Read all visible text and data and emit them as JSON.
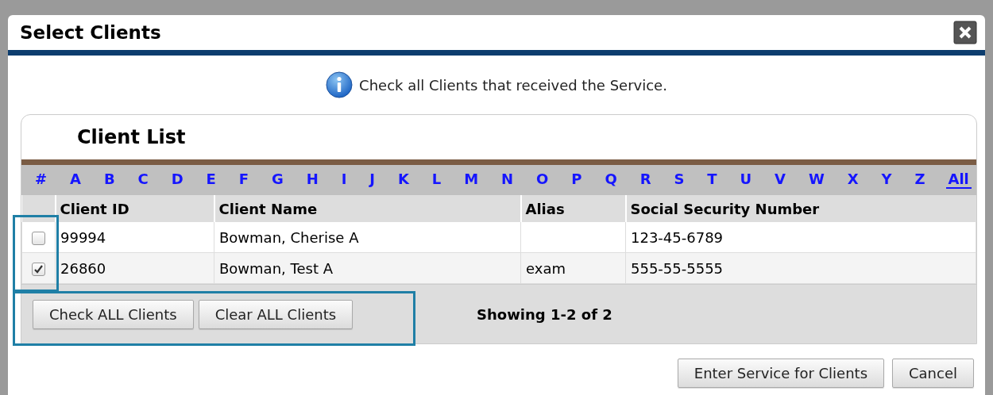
{
  "dialog": {
    "title": "Select Clients"
  },
  "info_message": "Check all Clients that received the Service.",
  "client_list": {
    "title": "Client List",
    "letters": [
      {
        "label": "#",
        "selected": false
      },
      {
        "label": "A",
        "selected": false
      },
      {
        "label": "B",
        "selected": false
      },
      {
        "label": "C",
        "selected": false
      },
      {
        "label": "D",
        "selected": false
      },
      {
        "label": "E",
        "selected": false
      },
      {
        "label": "F",
        "selected": false
      },
      {
        "label": "G",
        "selected": false
      },
      {
        "label": "H",
        "selected": false
      },
      {
        "label": "I",
        "selected": false
      },
      {
        "label": "J",
        "selected": false
      },
      {
        "label": "K",
        "selected": false
      },
      {
        "label": "L",
        "selected": false
      },
      {
        "label": "M",
        "selected": false
      },
      {
        "label": "N",
        "selected": false
      },
      {
        "label": "O",
        "selected": false
      },
      {
        "label": "P",
        "selected": false
      },
      {
        "label": "Q",
        "selected": false
      },
      {
        "label": "R",
        "selected": false
      },
      {
        "label": "S",
        "selected": false
      },
      {
        "label": "T",
        "selected": false
      },
      {
        "label": "U",
        "selected": false
      },
      {
        "label": "V",
        "selected": false
      },
      {
        "label": "W",
        "selected": false
      },
      {
        "label": "X",
        "selected": false
      },
      {
        "label": "Y",
        "selected": false
      },
      {
        "label": "Z",
        "selected": false
      },
      {
        "label": "All",
        "selected": true
      }
    ],
    "columns": [
      "Client ID",
      "Client Name",
      "Alias",
      "Social Security Number"
    ],
    "rows": [
      {
        "checked": false,
        "client_id": "99994",
        "client_name": "Bowman, Cherise A",
        "ssn": "123-45-6789"
      },
      {
        "checked": true,
        "client_id": "26860",
        "client_name": "Bowman, Test A",
        "alias": "exam",
        "ssn": "555-55-5555"
      }
    ],
    "buttons": [
      "Check ALL Clients",
      "Clear ALL Clients"
    ],
    "status": "Showing 1-2 of 2"
  },
  "footer_buttons": [
    "Enter Service for Clients",
    "Cancel"
  ]
}
